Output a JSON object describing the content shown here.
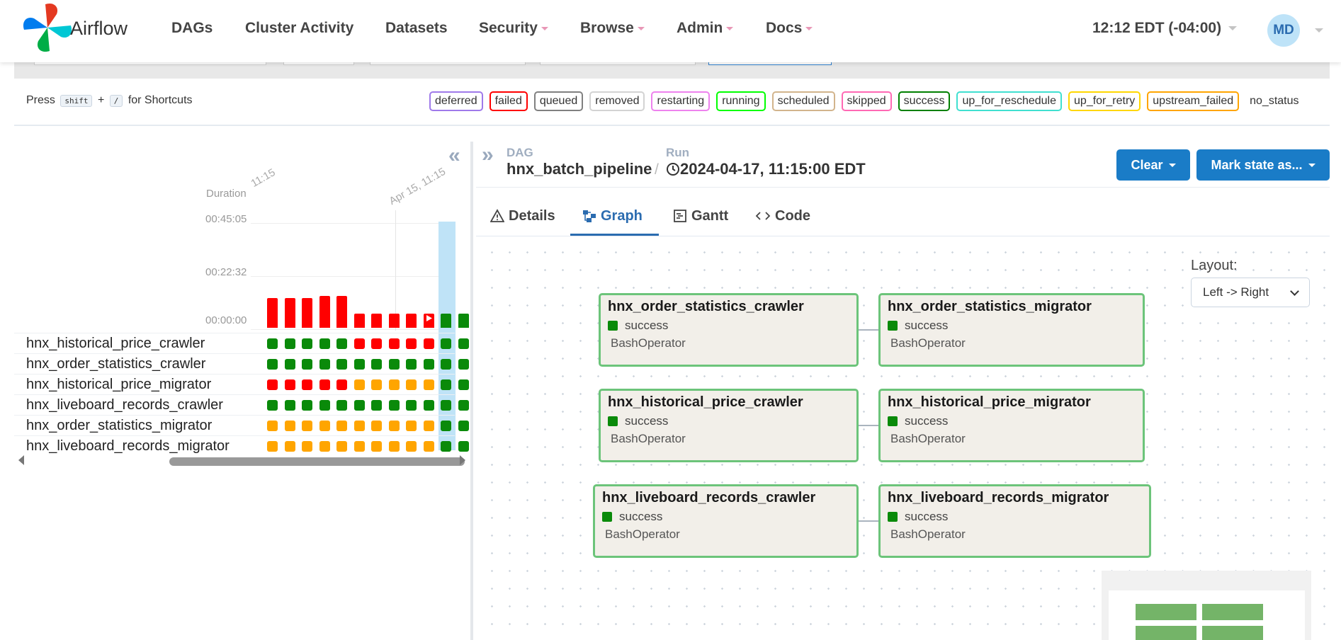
{
  "navbar": {
    "brand": "Airflow",
    "items": [
      "DAGs",
      "Cluster Activity",
      "Datasets",
      "Security",
      "Browse",
      "Admin",
      "Docs"
    ],
    "timezone": "12:12 EDT (-04:00)",
    "user_initials": "MD"
  },
  "shortcuts": {
    "prefix": "Press",
    "key1": "shift",
    "plus": "+",
    "key2": "/",
    "suffix": "for Shortcuts"
  },
  "legend": [
    {
      "label": "deferred",
      "color": "#9f7aea"
    },
    {
      "label": "failed",
      "color": "#ff0000"
    },
    {
      "label": "queued",
      "color": "#808080"
    },
    {
      "label": "removed",
      "color": "#d3d3d3"
    },
    {
      "label": "restarting",
      "color": "#ee82ee"
    },
    {
      "label": "running",
      "color": "#00ff00"
    },
    {
      "label": "scheduled",
      "color": "#d2b48c"
    },
    {
      "label": "skipped",
      "color": "#ff69b4"
    },
    {
      "label": "success",
      "color": "#008000"
    },
    {
      "label": "up_for_reschedule",
      "color": "#40e0d0"
    },
    {
      "label": "up_for_retry",
      "color": "#ffd700"
    },
    {
      "label": "upstream_failed",
      "color": "#ffa500"
    },
    {
      "label": "no_status",
      "color": ""
    }
  ],
  "grid": {
    "duration_label": "Duration",
    "time_label_1": "11:15",
    "time_label_2": "Apr 15, 11:15",
    "y_ticks": [
      "00:45:05",
      "00:22:32",
      "00:00:00"
    ],
    "run_bars": [
      {
        "state": "failed",
        "duration_frac": 0.28
      },
      {
        "state": "failed",
        "duration_frac": 0.28
      },
      {
        "state": "failed",
        "duration_frac": 0.28
      },
      {
        "state": "failed",
        "duration_frac": 0.3
      },
      {
        "state": "failed",
        "duration_frac": 0.3
      },
      {
        "state": "failed",
        "duration_frac": 0.13
      },
      {
        "state": "failed",
        "duration_frac": 0.13
      },
      {
        "state": "failed",
        "duration_frac": 0.13
      },
      {
        "state": "failed",
        "duration_frac": 0.13
      },
      {
        "state": "failed",
        "duration_frac": 0.13
      },
      {
        "state": "success",
        "duration_frac": 0.13
      },
      {
        "state": "success",
        "duration_frac": 0.13
      }
    ],
    "tasks": [
      {
        "name": "hnx_historical_price_crawler",
        "states": [
          "success",
          "success",
          "success",
          "success",
          "success",
          "failed",
          "failed",
          "failed",
          "failed",
          "failed",
          "success",
          "success"
        ]
      },
      {
        "name": "hnx_order_statistics_crawler",
        "states": [
          "success",
          "success",
          "success",
          "success",
          "success",
          "success",
          "success",
          "success",
          "success",
          "success",
          "success",
          "success"
        ]
      },
      {
        "name": "hnx_historical_price_migrator",
        "states": [
          "failed",
          "failed",
          "failed",
          "failed",
          "failed",
          "upstream_failed",
          "upstream_failed",
          "upstream_failed",
          "upstream_failed",
          "upstream_failed",
          "success",
          "success"
        ]
      },
      {
        "name": "hnx_liveboard_records_crawler",
        "states": [
          "success",
          "success",
          "success",
          "success",
          "success",
          "success",
          "success",
          "success",
          "success",
          "success",
          "success",
          "success"
        ]
      },
      {
        "name": "hnx_order_statistics_migrator",
        "states": [
          "upstream_failed",
          "upstream_failed",
          "upstream_failed",
          "upstream_failed",
          "upstream_failed",
          "upstream_failed",
          "upstream_failed",
          "upstream_failed",
          "upstream_failed",
          "upstream_failed",
          "success",
          "success"
        ]
      },
      {
        "name": "hnx_liveboard_records_migrator",
        "states": [
          "upstream_failed",
          "upstream_failed",
          "upstream_failed",
          "upstream_failed",
          "upstream_failed",
          "upstream_failed",
          "upstream_failed",
          "upstream_failed",
          "upstream_failed",
          "upstream_failed",
          "success",
          "success"
        ]
      }
    ]
  },
  "breadcrumb": {
    "dag_label": "DAG",
    "dag_name": "hnx_batch_pipeline",
    "separator": "/",
    "run_label": "Run",
    "run_value": "2024-04-17, 11:15:00 EDT"
  },
  "actions": {
    "clear": "Clear",
    "mark_state": "Mark state as..."
  },
  "tabs": [
    {
      "label": "Details",
      "icon": "warning-triangle-icon"
    },
    {
      "label": "Graph",
      "icon": "graph-icon"
    },
    {
      "label": "Gantt",
      "icon": "gantt-icon"
    },
    {
      "label": "Code",
      "icon": "code-icon"
    }
  ],
  "layout": {
    "label": "Layout:",
    "value": "Left -> Right"
  },
  "nodes": [
    {
      "id": "hnx_order_statistics_crawler",
      "state": "success",
      "operator": "BashOperator"
    },
    {
      "id": "hnx_order_statistics_migrator",
      "state": "success",
      "operator": "BashOperator"
    },
    {
      "id": "hnx_historical_price_crawler",
      "state": "success",
      "operator": "BashOperator"
    },
    {
      "id": "hnx_historical_price_migrator",
      "state": "success",
      "operator": "BashOperator"
    },
    {
      "id": "hnx_liveboard_records_crawler",
      "state": "success",
      "operator": "BashOperator"
    },
    {
      "id": "hnx_liveboard_records_migrator",
      "state": "success",
      "operator": "BashOperator"
    }
  ],
  "colors": {
    "primary": "#1a7cc7",
    "success": "#0a8a0a",
    "failed": "#ff0000",
    "upstream_failed": "#ffa500",
    "node_border": "#6cc47a"
  }
}
